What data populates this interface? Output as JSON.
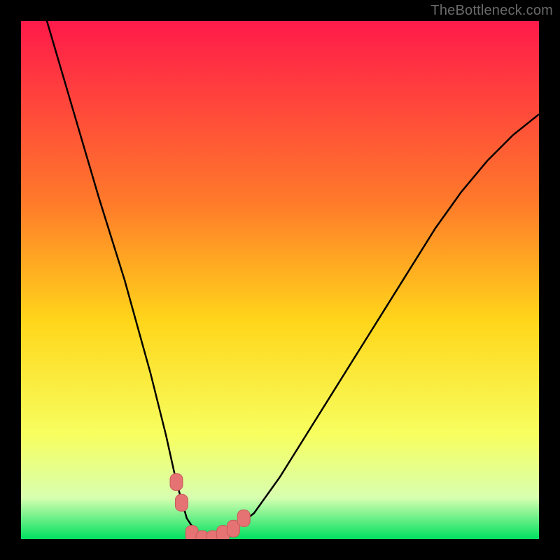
{
  "watermark": "TheBottleneck.com",
  "chart_data": {
    "type": "line",
    "title": "",
    "xlabel": "",
    "ylabel": "",
    "xlim": [
      0,
      100
    ],
    "ylim": [
      0,
      100
    ],
    "grid": false,
    "legend": false,
    "series": [
      {
        "name": "bottleneck-curve",
        "x": [
          0,
          5,
          10,
          15,
          20,
          25,
          28,
          30,
          32,
          34,
          36,
          38,
          40,
          45,
          50,
          55,
          60,
          65,
          70,
          75,
          80,
          85,
          90,
          95,
          100
        ],
        "y": [
          115,
          100,
          83,
          66,
          50,
          32,
          20,
          11,
          4,
          1,
          0,
          0,
          1,
          5,
          12,
          20,
          28,
          36,
          44,
          52,
          60,
          67,
          73,
          78,
          82
        ]
      }
    ],
    "markers": [
      {
        "name": "marker-a",
        "x": 30,
        "y": 11
      },
      {
        "name": "marker-b",
        "x": 31,
        "y": 7
      },
      {
        "name": "marker-c",
        "x": 33,
        "y": 1
      },
      {
        "name": "marker-d",
        "x": 35,
        "y": 0
      },
      {
        "name": "marker-e",
        "x": 37,
        "y": 0
      },
      {
        "name": "marker-f",
        "x": 39,
        "y": 1
      },
      {
        "name": "marker-g",
        "x": 41,
        "y": 2
      },
      {
        "name": "marker-h",
        "x": 43,
        "y": 4
      }
    ],
    "colors": {
      "gradient_top": "#ff1a4a",
      "gradient_mid_upper": "#ff7a2a",
      "gradient_mid": "#ffd61a",
      "gradient_mid_lower": "#f7ff60",
      "gradient_lower": "#d8ffb0",
      "gradient_bottom": "#00e060",
      "curve": "#000000",
      "marker_fill": "#e57373",
      "marker_stroke": "#c85a5a"
    }
  }
}
